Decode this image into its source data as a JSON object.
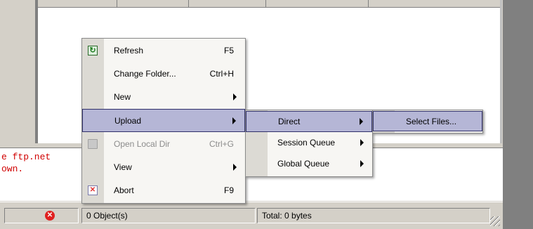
{
  "context_menu": {
    "items": [
      {
        "label": "Refresh",
        "shortcut": "F5",
        "icon": "refresh-icon"
      },
      {
        "label": "Change Folder...",
        "shortcut": "Ctrl+H"
      },
      {
        "label": "New"
      },
      {
        "label": "Upload"
      },
      {
        "label": "Open Local Dir",
        "shortcut": "Ctrl+G",
        "icon": "folder-icon",
        "disabled": true
      },
      {
        "label": "View"
      },
      {
        "label": "Abort",
        "shortcut": "F9",
        "icon": "abort-icon"
      }
    ]
  },
  "upload_submenu": {
    "items": [
      {
        "label": "Direct"
      },
      {
        "label": "Session Queue"
      },
      {
        "label": "Global Queue"
      }
    ]
  },
  "direct_submenu": {
    "items": [
      {
        "label": "Select Files..."
      }
    ]
  },
  "log": {
    "lines": [
      "e ftp.net",
      "own."
    ]
  },
  "status_bar": {
    "objects": "0 Object(s)",
    "total": "Total: 0 bytes",
    "error_icon": "error-icon"
  },
  "colors": {
    "highlight": "#b5b6d6",
    "log_text": "#d00000",
    "window_face": "#d4d0c8"
  }
}
